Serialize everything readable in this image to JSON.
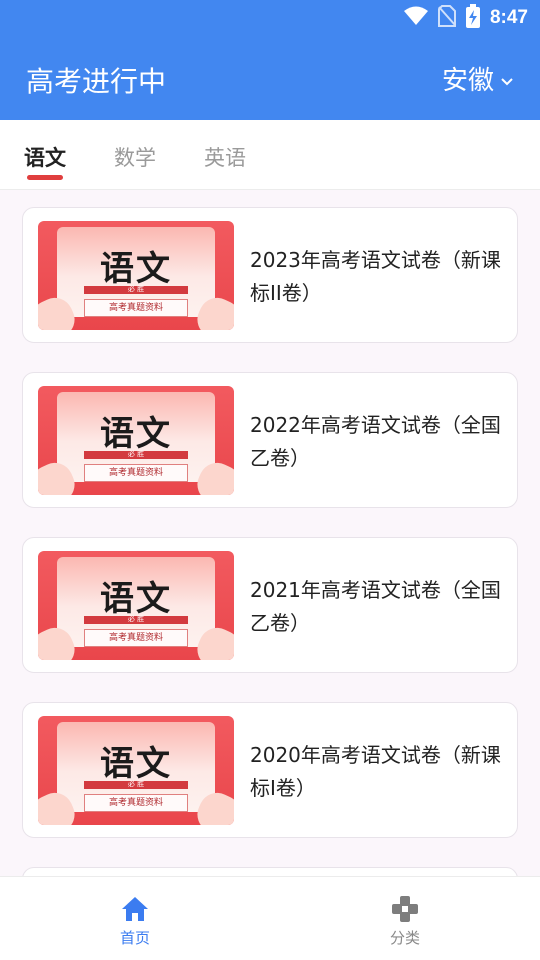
{
  "status_bar": {
    "time": "8:47",
    "icons": [
      "wifi-icon",
      "no-sim-icon",
      "battery-charging-icon"
    ]
  },
  "app_bar": {
    "title": "高考进行中",
    "region": "安徽",
    "region_icon": "chevron-down-icon"
  },
  "tabs": [
    {
      "label": "语文",
      "active": true
    },
    {
      "label": "数学",
      "active": false
    },
    {
      "label": "英语",
      "active": false
    }
  ],
  "thumbnail": {
    "subject": "语文",
    "band_text": "必 胜",
    "caption": "高考真题资料"
  },
  "papers": [
    {
      "title": "2023年高考语文试卷（新课标II卷）"
    },
    {
      "title": "2022年高考语文试卷（全国乙卷）"
    },
    {
      "title": "2021年高考语文试卷（全国乙卷）"
    },
    {
      "title": "2020年高考语文试卷（新课标I卷）"
    }
  ],
  "bottom_nav": [
    {
      "label": "首页",
      "icon": "home-icon",
      "active": true
    },
    {
      "label": "分类",
      "icon": "category-icon",
      "active": false
    }
  ],
  "colors": {
    "primary": "#4287f0",
    "accent_red": "#e03e3e",
    "active_nav": "#3b7cf0",
    "inactive_nav": "#8a8a8a"
  }
}
